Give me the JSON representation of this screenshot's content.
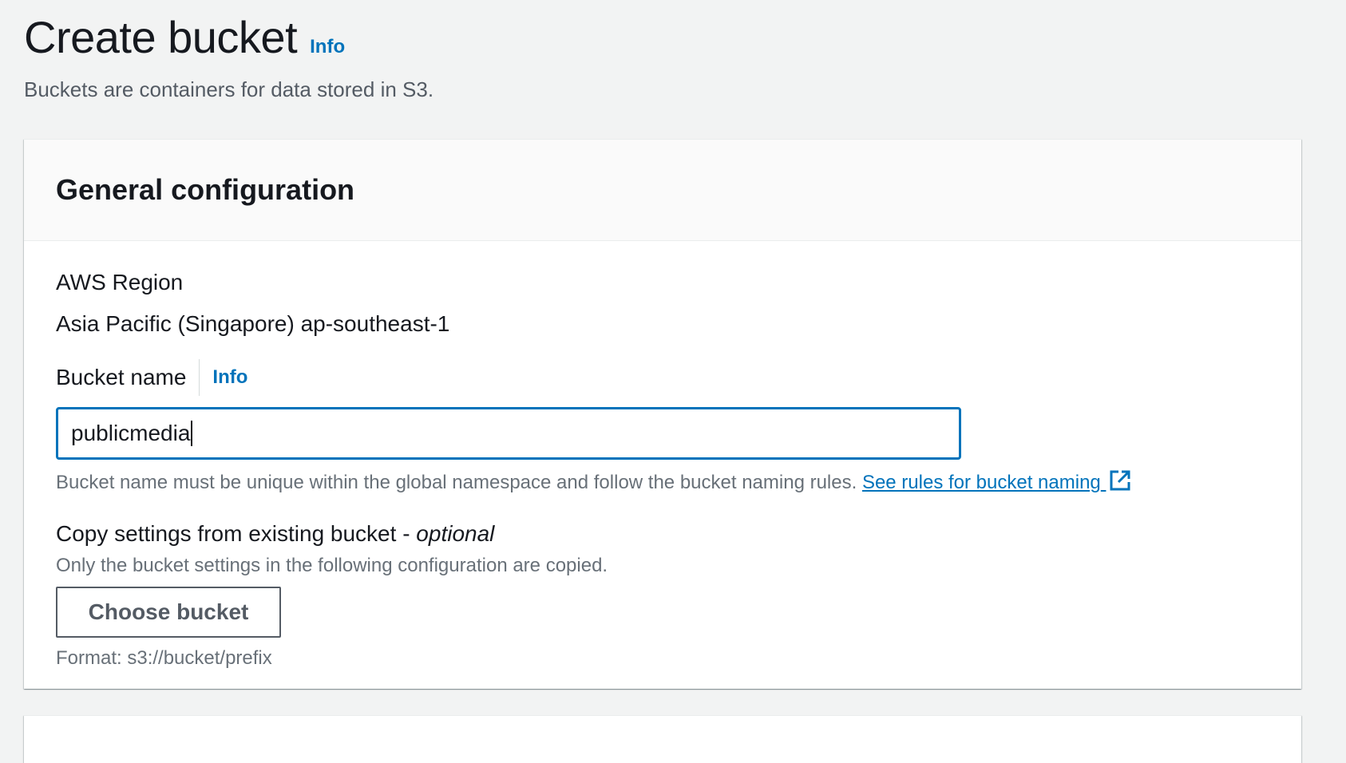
{
  "header": {
    "title": "Create bucket",
    "info_label": "Info",
    "description": "Buckets are containers for data stored in S3."
  },
  "general_config": {
    "title": "General configuration",
    "region": {
      "label": "AWS Region",
      "value": "Asia Pacific (Singapore) ap-southeast-1"
    },
    "bucket_name": {
      "label": "Bucket name",
      "info_label": "Info",
      "value": "publicmedia",
      "hint": "Bucket name must be unique within the global namespace and follow the bucket naming rules.",
      "rules_link": "See rules for bucket naming"
    },
    "copy_settings": {
      "label": "Copy settings from existing bucket - ",
      "label_optional": "optional",
      "description": "Only the bucket settings in the following configuration are copied.",
      "button_label": "Choose bucket",
      "format_hint": "Format: s3://bucket/prefix"
    }
  },
  "colors": {
    "link": "#0073bb",
    "input_focus_border": "#0073bb",
    "page_background": "#f2f3f3"
  },
  "icons": {
    "external_link": "external-link-icon"
  }
}
